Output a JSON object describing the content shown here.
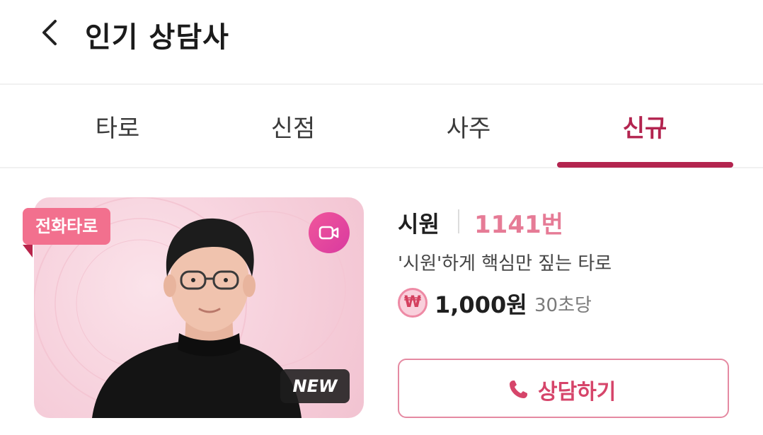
{
  "header": {
    "title": "인기 상담사"
  },
  "tabs": [
    {
      "label": "타로",
      "active": false
    },
    {
      "label": "신점",
      "active": false
    },
    {
      "label": "사주",
      "active": false
    },
    {
      "label": "신규",
      "active": true
    }
  ],
  "card": {
    "type_badge": "전화타로",
    "new_badge": "NEW",
    "video_icon": "video-camera-icon",
    "name": "시원",
    "number": "1141번",
    "description": "'시원'하게 핵심만 짚는 타로",
    "currency_icon": "₩",
    "price": "1,000원",
    "price_unit": "30초당",
    "consult_button": "상담하기"
  },
  "colors": {
    "accent": "#b3244f",
    "number_pink": "#e67b96",
    "badge_pink": "#f2708e",
    "button_pink": "#d6456a"
  }
}
